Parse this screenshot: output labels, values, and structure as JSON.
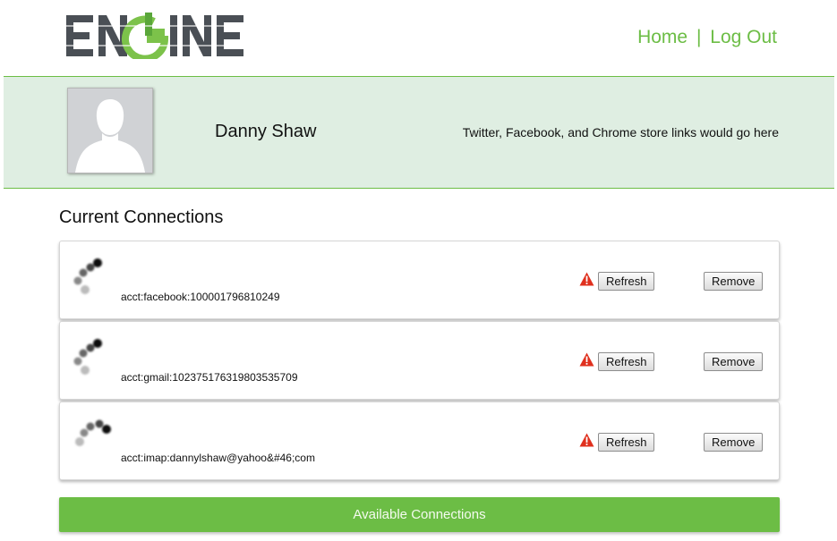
{
  "header": {
    "logo_text": "ENGINE",
    "nav": {
      "home": "Home",
      "separator": "|",
      "logout": "Log Out"
    }
  },
  "profile": {
    "name": "Danny Shaw",
    "social_note": "Twitter, Facebook, and Chrome store links would go here"
  },
  "connections": {
    "title": "Current Connections",
    "items": [
      {
        "account": "acct:facebook:100001796810249",
        "refresh_label": "Refresh",
        "remove_label": "Remove"
      },
      {
        "account": "acct:gmail:102375176319803535709",
        "refresh_label": "Refresh",
        "remove_label": "Remove"
      },
      {
        "account": "acct:imap:dannylshaw@yahoo&#46;com",
        "refresh_label": "Refresh",
        "remove_label": "Remove"
      }
    ]
  },
  "available_button": "Available Connections",
  "colors": {
    "brand_green": "#6cbd45",
    "band_bg": "#dfeee2",
    "logo_gray": "#4a4f55",
    "warning_red": "#e0301e"
  },
  "icons": {
    "avatar": "default-person-silhouette",
    "connection": "connection-dots-icon",
    "warning": "warning-triangle-icon"
  }
}
